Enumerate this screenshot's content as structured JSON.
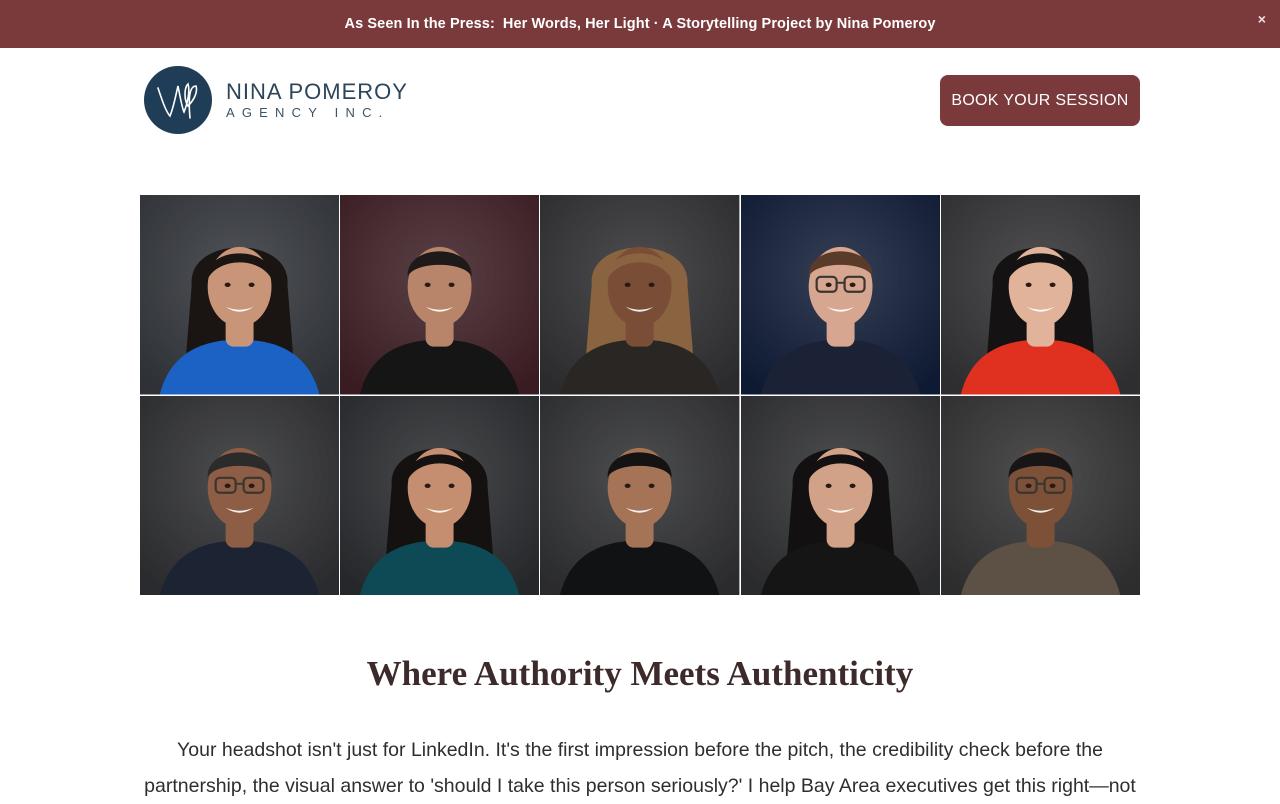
{
  "announcement": {
    "prefix": "As Seen In the Press:",
    "text": "Her Words, Her Light · A Storytelling Project by Nina Pomeroy",
    "close_icon": "×"
  },
  "logo": {
    "name": "NINA POMEROY",
    "subtitle": "AGENCY INC."
  },
  "cta": {
    "label": "BOOK YOUR SESSION"
  },
  "colors": {
    "brand": "#7a3a3c",
    "logo_navy": "#1f3d56",
    "heading": "#3d2a2a"
  },
  "portraits": [
    {
      "name": "woman-blue-top",
      "bg": "#2f3236",
      "skin": "#c99578",
      "hair": "#1a1412",
      "shirt": "#1b62c4",
      "glasses": false,
      "long_hair": true
    },
    {
      "name": "man-black-shirt",
      "bg": "#3a1c22",
      "skin": "#b8856a",
      "hair": "#1d1a19",
      "shirt": "#151515",
      "glasses": false,
      "long_hair": false
    },
    {
      "name": "woman-curly-hair",
      "bg": "#2c2c2e",
      "skin": "#7a4d36",
      "hair": "#8a6340",
      "shirt": "#2a2624",
      "glasses": false,
      "long_hair": true
    },
    {
      "name": "man-glasses-blazer",
      "bg": "#0f1a33",
      "skin": "#d7a690",
      "hair": "#5a3a28",
      "shirt": "#1b2236",
      "glasses": true,
      "long_hair": false
    },
    {
      "name": "woman-red-top",
      "bg": "#2e2e30",
      "skin": "#e0b39a",
      "hair": "#141212",
      "shirt": "#e0301f",
      "glasses": false,
      "long_hair": true
    },
    {
      "name": "man-glasses-navy-suit",
      "bg": "#2a2b2e",
      "skin": "#8d5e45",
      "hair": "#2b2b2b",
      "shirt": "#1c2333",
      "glasses": true,
      "long_hair": false
    },
    {
      "name": "woman-teal-top",
      "bg": "#26272a",
      "skin": "#c58e70",
      "hair": "#141110",
      "shirt": "#0e4a55",
      "glasses": false,
      "long_hair": true
    },
    {
      "name": "man-mustache",
      "bg": "#2b2c2e",
      "skin": "#a57456",
      "hair": "#141212",
      "shirt": "#111214",
      "glasses": false,
      "long_hair": false
    },
    {
      "name": "woman-black-top",
      "bg": "#2a2b2d",
      "skin": "#d2a288",
      "hair": "#121010",
      "shirt": "#151515",
      "glasses": false,
      "long_hair": true
    },
    {
      "name": "man-glasses-tan-suit",
      "bg": "#2d2d2f",
      "skin": "#7d5038",
      "hair": "#171515",
      "shirt": "#5d5045",
      "glasses": true,
      "long_hair": false
    }
  ],
  "main": {
    "headline": "Where Authority Meets Authenticity",
    "body": "Your headshot isn't just for LinkedIn. It's the first impression before the pitch, the credibility check before the partnership, the visual answer to 'should I take this person seriously?' I help Bay Area executives get this right—not"
  }
}
